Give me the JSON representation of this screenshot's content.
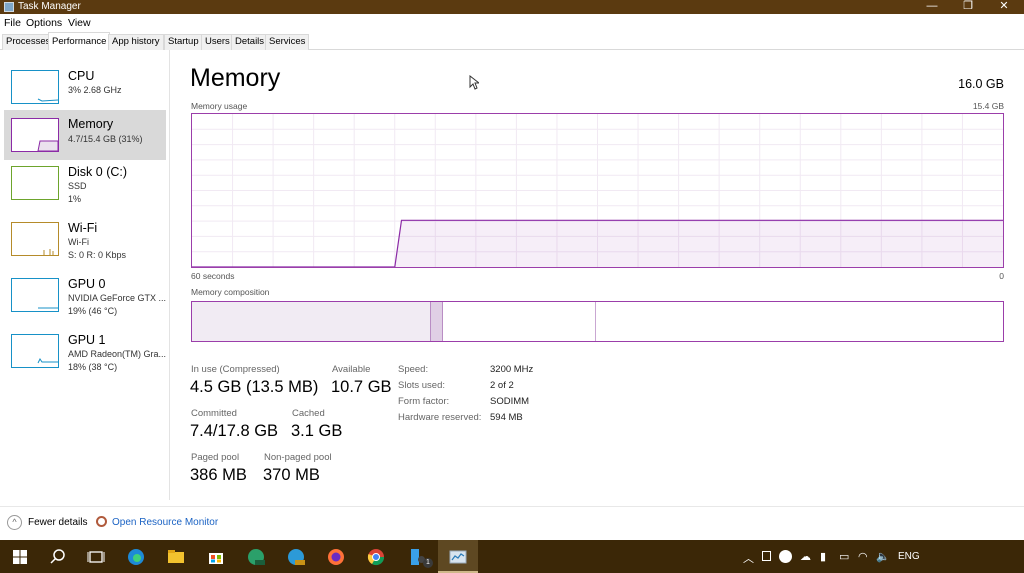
{
  "window": {
    "title": "Task Manager",
    "minimize": "—",
    "restore": "❐",
    "close": "✕"
  },
  "menu": [
    "File",
    "Options",
    "View"
  ],
  "tabs": [
    "Processes",
    "Performance",
    "App history",
    "Startup",
    "Users",
    "Details",
    "Services"
  ],
  "sidebar": [
    {
      "name": "CPU",
      "sub1": "3%  2.68 GHz",
      "sub2": "",
      "sub3": "",
      "color": "#1791c7"
    },
    {
      "name": "Memory",
      "sub1": "4.7/15.4 GB (31%)",
      "sub2": "",
      "sub3": "",
      "color": "#8b2aa6"
    },
    {
      "name": "Disk 0 (C:)",
      "sub1": "SSD",
      "sub2": "1%",
      "sub3": "",
      "color": "#6da42c"
    },
    {
      "name": "Wi-Fi",
      "sub1": "Wi-Fi",
      "sub2": "S: 0  R: 0 Kbps",
      "sub3": "",
      "color": "#b58b2a"
    },
    {
      "name": "GPU 0",
      "sub1": "NVIDIA GeForce GTX ...",
      "sub2": "19%  (46 °C)",
      "sub3": "",
      "color": "#1791c7"
    },
    {
      "name": "GPU 1",
      "sub1": "AMD Radeon(TM) Gra...",
      "sub2": "18%  (38 °C)",
      "sub3": "",
      "color": "#1791c7"
    }
  ],
  "main": {
    "title": "Memory",
    "total": "16.0 GB",
    "usage_label": "Memory usage",
    "usage_max": "15.4 GB",
    "time_left": "60 seconds",
    "time_right": "0",
    "composition_label": "Memory composition"
  },
  "chart_data": {
    "type": "area",
    "title": "Memory usage",
    "x": [
      60,
      45,
      44.5,
      0
    ],
    "y": [
      0,
      0,
      4.7,
      4.7
    ],
    "xlabel": "",
    "ylabel": "",
    "xlim": [
      60,
      0
    ],
    "ylim": [
      0,
      15.4
    ],
    "grid": true
  },
  "composition": {
    "in_use_fraction": 0.293,
    "modified_fraction": 0.016,
    "standby_fraction": 0.189,
    "free_fraction": 0.502
  },
  "stats": {
    "in_use_label": "In use (Compressed)",
    "in_use_value": "4.5 GB (13.5 MB)",
    "available_label": "Available",
    "available_value": "10.7 GB",
    "committed_label": "Committed",
    "committed_value": "7.4/17.8 GB",
    "cached_label": "Cached",
    "cached_value": "3.1 GB",
    "paged_label": "Paged pool",
    "paged_value": "386 MB",
    "nonpaged_label": "Non-paged pool",
    "nonpaged_value": "370 MB"
  },
  "details": [
    {
      "label": "Speed:",
      "value": "3200 MHz"
    },
    {
      "label": "Slots used:",
      "value": "2 of 2"
    },
    {
      "label": "Form factor:",
      "value": "SODIMM"
    },
    {
      "label": "Hardware reserved:",
      "value": "594 MB"
    }
  ],
  "footer": {
    "fewer_details": "Fewer details",
    "open_monitor": "Open Resource Monitor"
  },
  "taskbar": {
    "language": "ENG",
    "badge": "1"
  },
  "colors": {
    "accent": "#8b2aa6",
    "titlebar": "#5b3a10",
    "taskbar": "#3b2707",
    "link": "#1b63c4"
  }
}
